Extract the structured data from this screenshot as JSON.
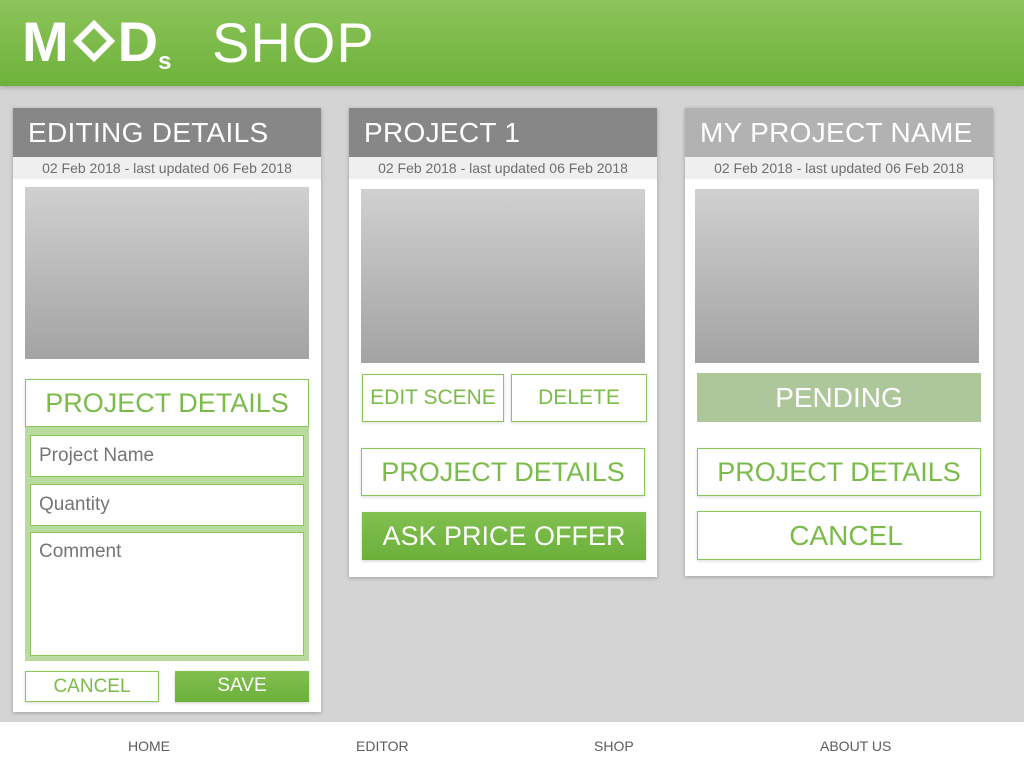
{
  "header": {
    "logo_main_1": "M",
    "logo_main_2": "D",
    "logo_sub": "s",
    "title": "SHOP"
  },
  "cards": [
    {
      "title": "EDITING DETAILS",
      "dates": "02 Feb 2018 - last updated 06 Feb 2018",
      "details_label": "PROJECT DETAILS",
      "project_name_placeholder": "Project Name",
      "quantity_placeholder": "Quantity",
      "comment_placeholder": "Comment",
      "cancel_label": "CANCEL",
      "save_label": "SAVE"
    },
    {
      "title": "PROJECT 1",
      "dates": "02 Feb 2018 - last updated 06 Feb 2018",
      "edit_scene_label": "EDIT SCENE",
      "delete_label": "DELETE",
      "details_label": "PROJECT DETAILS",
      "ask_price_label": "ASK PRICE OFFER"
    },
    {
      "title": "MY PROJECT NAME",
      "dates": "02 Feb 2018 - last updated 06 Feb 2018",
      "status_label": "PENDING",
      "details_label": "PROJECT DETAILS",
      "cancel_label": "CANCEL"
    }
  ],
  "footer": {
    "items": [
      "HOME",
      "EDITOR",
      "SHOP",
      "ABOUT US"
    ]
  },
  "colors": {
    "accent": "#7bbb4a",
    "header_green": "#7cbb49",
    "card_header_dark": "#868686",
    "card_header_light": "#b3b3b3",
    "pending": "#aec79c",
    "background": "#d4d4d4"
  }
}
